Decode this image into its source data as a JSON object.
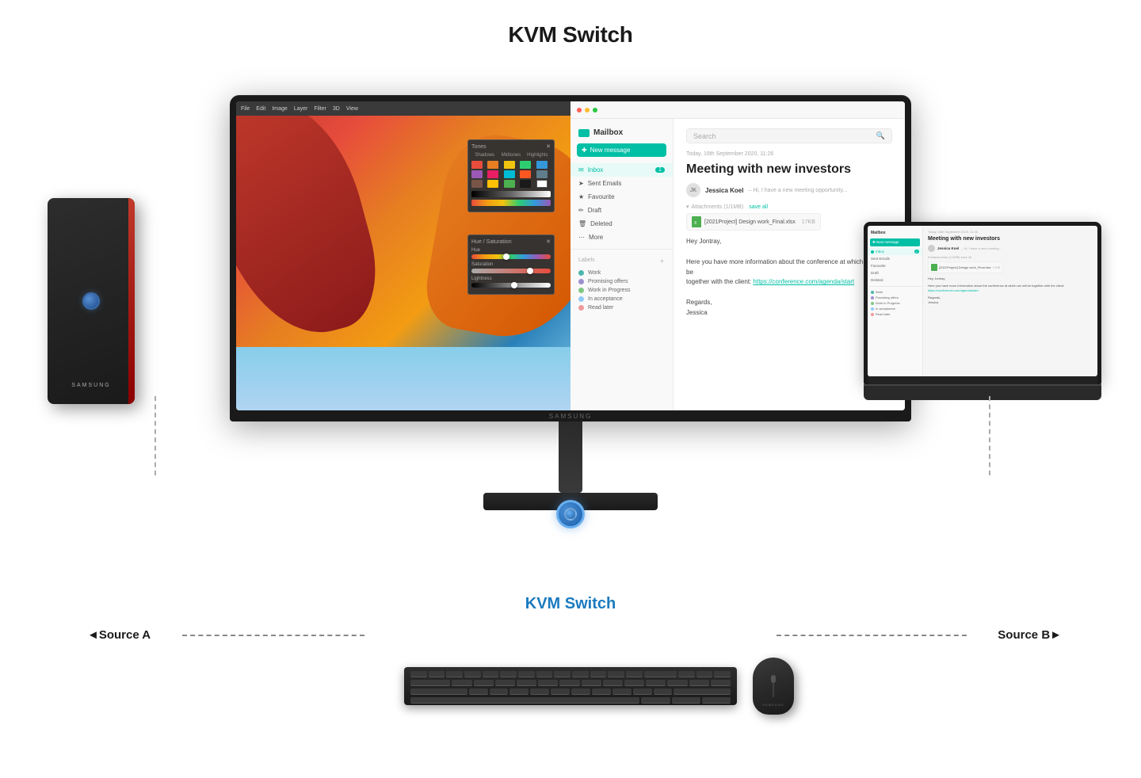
{
  "page": {
    "title": "KVM Switch",
    "kvm_switch_label": "KVM Switch"
  },
  "monitor": {
    "samsung_logo": "SAMSUNG"
  },
  "mailbox": {
    "app_name": "Mailbox",
    "search_placeholder": "Search",
    "new_message_btn": "New message",
    "date": "Today, 16th September 2020, 11:26",
    "email_subject": "Meeting with new investors",
    "sender_name": "Jessica Koel",
    "sender_preview": "– Hi, I have a new meeting opportunity...",
    "attachments_label": "Attachments (1/1MB)",
    "save_all": "save all",
    "attachment_name": "[2021Project] Design work_Final.xlsx",
    "attachment_size": "17KB",
    "email_body_line1": "Hey Jontray,",
    "email_body_line2": "Here you have more information about the conference at which we will be",
    "email_body_line3": "together with the client:",
    "email_link": "https://conference.com/agenda/start",
    "email_body_line4": "Regards,",
    "email_body_line5": "Jessica",
    "sidebar": {
      "items": [
        {
          "label": "Inbox",
          "badge": "1",
          "active": true
        },
        {
          "label": "Sent Emails",
          "badge": "",
          "active": false
        },
        {
          "label": "Favourite",
          "badge": "",
          "active": false
        },
        {
          "label": "Draft",
          "badge": "",
          "active": false
        },
        {
          "label": "Deleted",
          "badge": "",
          "active": false
        },
        {
          "label": "More",
          "badge": "",
          "active": false
        }
      ],
      "labels_header": "Labels",
      "labels": [
        {
          "label": "Work",
          "color": "#4db6ac"
        },
        {
          "label": "Promising offers",
          "color": "#9c8fce"
        },
        {
          "label": "Work in Progress",
          "color": "#81c784"
        },
        {
          "label": "In acceptance",
          "color": "#90caf9"
        },
        {
          "label": "Read later",
          "color": "#ef9a9a"
        }
      ]
    }
  },
  "photoshop": {
    "menu_items": [
      "File",
      "Edit",
      "Image",
      "Layer",
      "Filter",
      "3D",
      "View"
    ],
    "panel_tones": "Tones",
    "col_shadows": "Shadows",
    "col_midtones": "Midtones",
    "col_highlights": "Highlights",
    "panel_hue": "Hue / Saturation",
    "hue_label": "Hue",
    "saturation_label": "Saturation",
    "lightness_label": "Lightness"
  },
  "source_a": "◄Source A",
  "source_b": "Source B►",
  "tower": {
    "samsung": "SAMSUNG"
  },
  "laptop": {
    "subject": "Meeting with new investors"
  }
}
